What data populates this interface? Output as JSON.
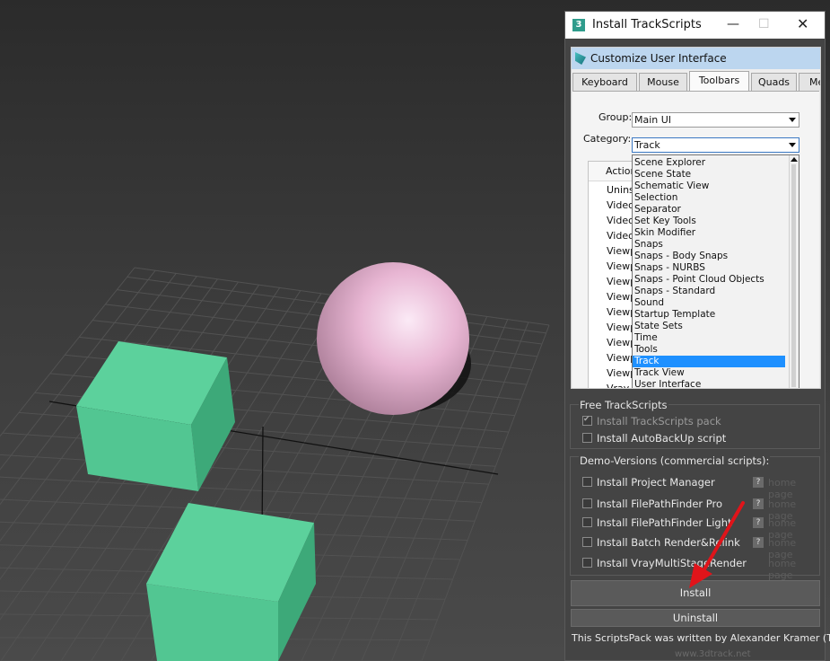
{
  "dialog": {
    "title": "Install TrackScripts",
    "app_icon": "3",
    "min_symbol": "—",
    "max_symbol": "☐",
    "close_symbol": "✕"
  },
  "cui": {
    "title": "Customize User Interface",
    "tabs": [
      {
        "label": "Keyboard"
      },
      {
        "label": "Mouse"
      },
      {
        "label": "Toolbars",
        "active": true
      },
      {
        "label": "Quads"
      },
      {
        "label": "Me"
      }
    ],
    "group_label": "Group:",
    "group_value": "Main UI",
    "category_label": "Category:",
    "category_value": "Track",
    "actions_header": "Action",
    "actions": [
      "Unins",
      "Video",
      "Video",
      "Video",
      "Viewp",
      "Viewp",
      "Viewp",
      "Viewp",
      "Viewp",
      "Viewp",
      "Viewp",
      "Viewp",
      "Viewp",
      "Vray"
    ],
    "category_options": [
      "Scene Explorer",
      "Scene State",
      "Schematic View",
      "Selection",
      "Separator",
      "Set Key Tools",
      "Skin Modifier",
      "Snaps",
      "Snaps - Body Snaps",
      "Snaps - NURBS",
      "Snaps - Point Cloud Objects",
      "Snaps - Standard",
      "Sound",
      "Startup Template",
      "State Sets",
      "Time",
      "Tools",
      "Track",
      "Track View",
      "User Interface"
    ],
    "selected_option": "Track"
  },
  "free_section": {
    "title": "Free TrackScripts",
    "items": [
      {
        "label": "Install TrackScripts pack",
        "checked": true,
        "disabled": true
      },
      {
        "label": "Install AutoBackUp script",
        "checked": false,
        "disabled": false
      }
    ]
  },
  "demo_section": {
    "title": "Demo-Versions (commercial scripts):",
    "help_label": "?",
    "items": [
      {
        "label": "Install Project Manager",
        "help": true,
        "link": "home page"
      },
      {
        "label": "Install FilePathFinder Pro",
        "help": true,
        "link": "home page"
      },
      {
        "label": "Install FilePathFinder Light",
        "help": true,
        "link": "home page"
      },
      {
        "label": "Install Batch Render&Relink",
        "help": true,
        "link": "home page"
      },
      {
        "label": "Install VrayMultiStageRender",
        "help": false,
        "link": "home page"
      }
    ]
  },
  "buttons": {
    "install": "Install",
    "uninstall": "Uninstall"
  },
  "footer": {
    "text": "This ScriptsPack was written by Alexander Kramer (Track)",
    "link": "www.3dtrack.net"
  },
  "colors": {
    "cube": "#55c995",
    "sphere": "#e9b9d6",
    "selection": "#1e90ff",
    "arrow": "#e0141a"
  }
}
